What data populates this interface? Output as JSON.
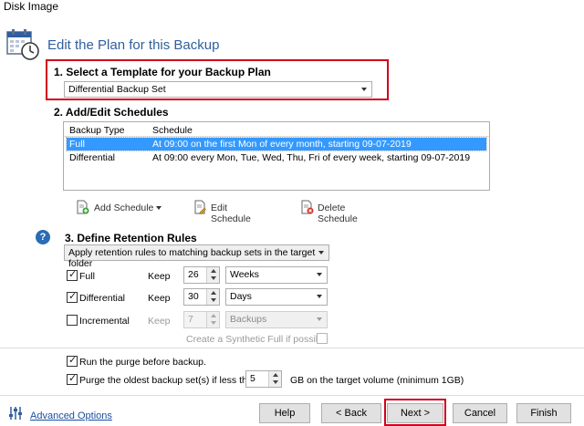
{
  "window": {
    "title": "Disk Image"
  },
  "header": {
    "title": "Edit the Plan for this Backup",
    "icon": "calendar-clock-icon"
  },
  "template_section": {
    "heading": "1. Select a Template for your Backup Plan",
    "selected": "Differential Backup Set"
  },
  "schedules_section": {
    "heading": "2. Add/Edit Schedules",
    "columns": [
      "Backup Type",
      "Schedule"
    ],
    "rows": [
      {
        "type": "Full",
        "schedule": "At 09:00 on the first Mon of every month, starting 09-07-2019",
        "selected": true
      },
      {
        "type": "Differential",
        "schedule": "At 09:00 every Mon, Tue, Wed, Thu, Fri of every week, starting 09-07-2019",
        "selected": false
      }
    ],
    "toolbar": {
      "add": "Add Schedule",
      "edit": "Edit Schedule",
      "delete": "Delete Schedule"
    }
  },
  "retention_section": {
    "heading": "3. Define Retention Rules",
    "rule_mode": "Apply retention rules to matching backup sets in the target folder",
    "keep_label": "Keep",
    "rules": [
      {
        "label": "Full",
        "checked": true,
        "enabled": true,
        "keep": "26",
        "unit": "Weeks"
      },
      {
        "label": "Differential",
        "checked": true,
        "enabled": true,
        "keep": "30",
        "unit": "Days"
      },
      {
        "label": "Incremental",
        "checked": false,
        "enabled": false,
        "keep": "7",
        "unit": "Backups"
      }
    ],
    "synthetic_label": "Create a Synthetic Full if possible"
  },
  "options": {
    "run_purge": {
      "label": "Run the purge before backup.",
      "checked": true
    },
    "purge_oldest": {
      "label": "Purge the oldest backup set(s) if less than",
      "value": "5",
      "suffix": "GB on the target volume (minimum 1GB)",
      "checked": true
    }
  },
  "footer": {
    "advanced": "Advanced Options",
    "help": "Help",
    "back": "< Back",
    "next": "Next >",
    "cancel": "Cancel",
    "finish": "Finish"
  },
  "colors": {
    "accent": "#2f5f9e",
    "highlight": "#d0021b",
    "selection": "#3399ff"
  }
}
